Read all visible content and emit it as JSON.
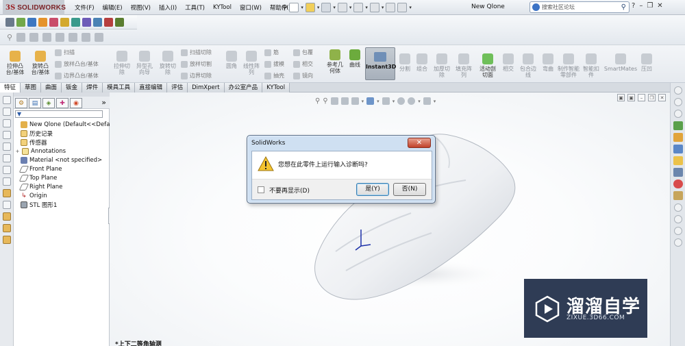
{
  "app": {
    "logo_text": "SOLIDWORKS",
    "document_title": "New Qlone"
  },
  "menu": [
    "文件(F)",
    "编辑(E)",
    "视图(V)",
    "插入(I)",
    "工具(T)",
    "KYTool",
    "窗口(W)",
    "帮助(H)"
  ],
  "search": {
    "placeholder": "搜索社区论坛"
  },
  "ribbon": {
    "extrude_boss": "拉伸凸台/基体",
    "revolve_boss": "旋转凸台/基体",
    "sweep": "扫描",
    "loft": "放样凸台/基体",
    "boundary_boss": "边界凸台/基体",
    "extrude_cut": "拉伸切除",
    "hole_wizard": "异型孔向导",
    "revolve_cut": "旋转切除",
    "swept_cut": "扫描切除",
    "lofted_cut": "放样切割",
    "boundary_cut": "边界切除",
    "fillet": "圆角",
    "linear_pattern": "线性阵列",
    "rib": "筋",
    "draft": "拔模",
    "shell": "抽壳",
    "wrap": "包覆",
    "intersect": "相交",
    "mirror": "镜向",
    "ref_geometry": "参考几何体",
    "curves": "曲线",
    "instant3d": "Instant3D",
    "split": "分割",
    "combine": "组合",
    "thicken_cut": "加厚切除",
    "fill_pattern": "填充阵列",
    "live_section": "活动剖切面",
    "intersect2": "相交",
    "wrap_edge": "包合边线",
    "flex": "弯曲",
    "make_part": "制作智能零部件",
    "smart_fastener": "智能扣件",
    "smartmates": "SmartMates",
    "indent": "压凹"
  },
  "tabs": [
    "特征",
    "草图",
    "曲面",
    "钣金",
    "焊件",
    "模具工具",
    "直接编辑",
    "评估",
    "DimXpert",
    "办公室产品",
    "KYTool"
  ],
  "tree": {
    "root": "New Qlone  (Default<<Defa",
    "items": [
      "历史记录",
      "传感器",
      "Annotations",
      "Material <not specified>",
      "Front Plane",
      "Top Plane",
      "Right Plane",
      "Origin",
      "STL 图形1"
    ]
  },
  "viewport": {
    "view_name": "*上下二等角轴测"
  },
  "dialog": {
    "title": "SolidWorks",
    "message": "您想在此零件上运行输入诊断吗?",
    "checkbox_label": "不要再显示(D)",
    "yes": "是(Y)",
    "no": "否(N)"
  },
  "watermark": {
    "text": "溜溜自学",
    "url": "ZIXUE.3D66.COM"
  }
}
